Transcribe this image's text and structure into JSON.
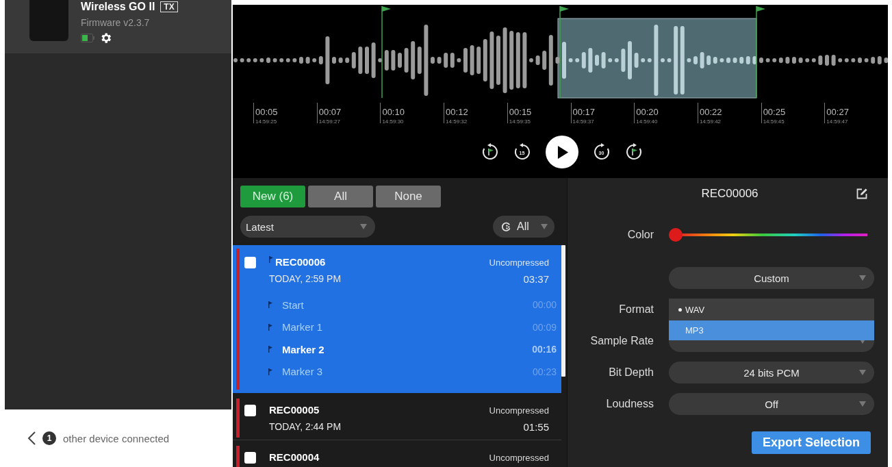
{
  "device": {
    "name": "Wireless GO II",
    "badge": "TX",
    "firmware": "Firmware v2.3.7"
  },
  "footer": {
    "count": "1",
    "text": "other device connected"
  },
  "timeline": {
    "ticks": [
      {
        "time": "00:05",
        "clock": "14:59:25"
      },
      {
        "time": "00:07",
        "clock": "14:59:27"
      },
      {
        "time": "00:10",
        "clock": "14:59:30"
      },
      {
        "time": "00:12",
        "clock": "14:59:32"
      },
      {
        "time": "00:15",
        "clock": "14:59:35"
      },
      {
        "time": "00:17",
        "clock": "14:59:37"
      },
      {
        "time": "00:20",
        "clock": "14:59:40"
      },
      {
        "time": "00:22",
        "clock": "14:59:42"
      },
      {
        "time": "00:25",
        "clock": "14:59:45"
      },
      {
        "time": "00:27",
        "clock": "14:59:47"
      }
    ]
  },
  "playback": {
    "controls": [
      {
        "kind": "prev-marker"
      },
      {
        "kind": "rewind",
        "label": "15"
      },
      {
        "kind": "play"
      },
      {
        "kind": "forward",
        "label": "30"
      },
      {
        "kind": "next-marker"
      }
    ]
  },
  "filters": [
    {
      "label": "New (6)",
      "selected": true
    },
    {
      "label": "All",
      "selected": false
    },
    {
      "label": "None",
      "selected": false
    }
  ],
  "sort": {
    "value": "Latest"
  },
  "color_filter": {
    "value": "All"
  },
  "recordings": [
    {
      "name": "REC00006",
      "date": "TODAY, 2:59 PM",
      "type": "Uncompressed",
      "duration": "03:37",
      "selected": true,
      "checked": false,
      "color": "#c8202a",
      "markers": [
        {
          "label": "Start",
          "time": "00:00",
          "selected": false
        },
        {
          "label": "Marker 1",
          "time": "00:09",
          "selected": false
        },
        {
          "label": "Marker 2",
          "time": "00:16",
          "selected": true
        },
        {
          "label": "Marker 3",
          "time": "00:23",
          "selected": false
        }
      ]
    },
    {
      "name": "REC00005",
      "date": "TODAY, 2:44 PM",
      "type": "Uncompressed",
      "duration": "01:55",
      "selected": false,
      "checked": false,
      "color": "#c8202a"
    },
    {
      "name": "REC00004",
      "type": "Uncompressed",
      "selected": false,
      "checked": false,
      "color": "#c8202a"
    }
  ],
  "details": {
    "title": "REC00006",
    "color": {
      "label": "Color",
      "level": 0
    },
    "preset": {
      "value": "Custom"
    },
    "fields": [
      {
        "kind": "menu",
        "label": "Format",
        "options": [
          {
            "label": "WAV",
            "selected": true,
            "highlighted": false
          },
          {
            "label": "MP3",
            "selected": false,
            "highlighted": true
          }
        ]
      },
      {
        "kind": "dropdown",
        "label": "Sample Rate"
      },
      {
        "kind": "dropdown",
        "label": "Bit Depth",
        "value": "24 bits PCM"
      },
      {
        "kind": "dropdown",
        "label": "Loudness",
        "value": "Off"
      }
    ],
    "export_button": "Export Selection"
  }
}
